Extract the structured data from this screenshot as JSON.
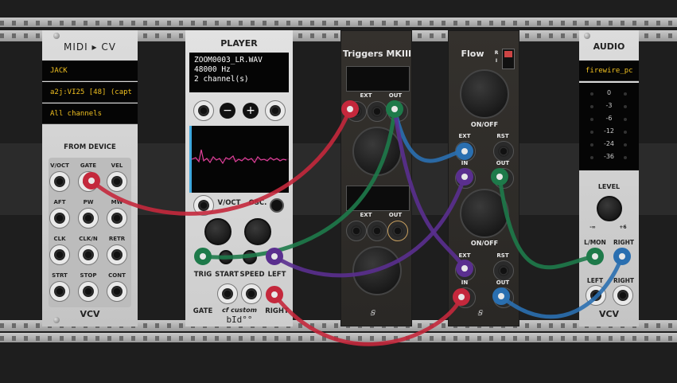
{
  "rack": {
    "background": "#1e1e1e"
  },
  "midi_cv": {
    "title": "MIDI ▸ CV",
    "driver": "JACK",
    "device": "a2j:VI25 [48] (capt",
    "channel": "All channels",
    "section_label": "FROM DEVICE",
    "jacks": [
      "V/OCT",
      "GATE",
      "VEL",
      "AFT",
      "PW",
      "MW",
      "CLK",
      "CLK/N",
      "RETR",
      "STRT",
      "STOP",
      "CONT"
    ],
    "brand": "VCV"
  },
  "player": {
    "title": "PLAYER",
    "filename": "ZOOM0003_LR.WAV",
    "samplerate": "48000 Hz",
    "channels": "2 channel(s)",
    "minus": "−",
    "plus": "+",
    "voct": "V/OCT",
    "osc": "OSC.",
    "trig": "TRIG",
    "start": "START",
    "speed": "SPEED",
    "left": "LEFT",
    "gate": "GATE",
    "right": "RIGHT",
    "brand": "cf custom",
    "brand2": "bId°°"
  },
  "triggers": {
    "title": "Triggers MKIII",
    "ext1": "EXT",
    "out1": "OUT",
    "ext2": "EXT",
    "out2": "OUT"
  },
  "flow": {
    "title": "Flow",
    "switch_r": "R",
    "switch_i": "I",
    "onoff1": "ON/OFF",
    "ext1": "EXT",
    "rst1": "RST",
    "in1": "IN",
    "out1": "OUT",
    "onoff2": "ON/OFF",
    "ext2": "EXT",
    "rst2": "RST",
    "in2": "IN",
    "out2": "OUT"
  },
  "audio": {
    "title": "AUDIO",
    "device": "firewire_pc",
    "meter": [
      "0",
      "-3",
      "-6",
      "-12",
      "-24",
      "-36"
    ],
    "level": "LEVEL",
    "min": "-∞",
    "max": "+6",
    "lmon": "L/MON",
    "right": "RIGHT",
    "left": "LEFT",
    "right2": "RIGHT",
    "brand": "VCV"
  },
  "cable_colors": {
    "red": "#c4283c",
    "green": "#1e7a4a",
    "blue": "#2a6fb0",
    "purple": "#5a2f8f"
  }
}
